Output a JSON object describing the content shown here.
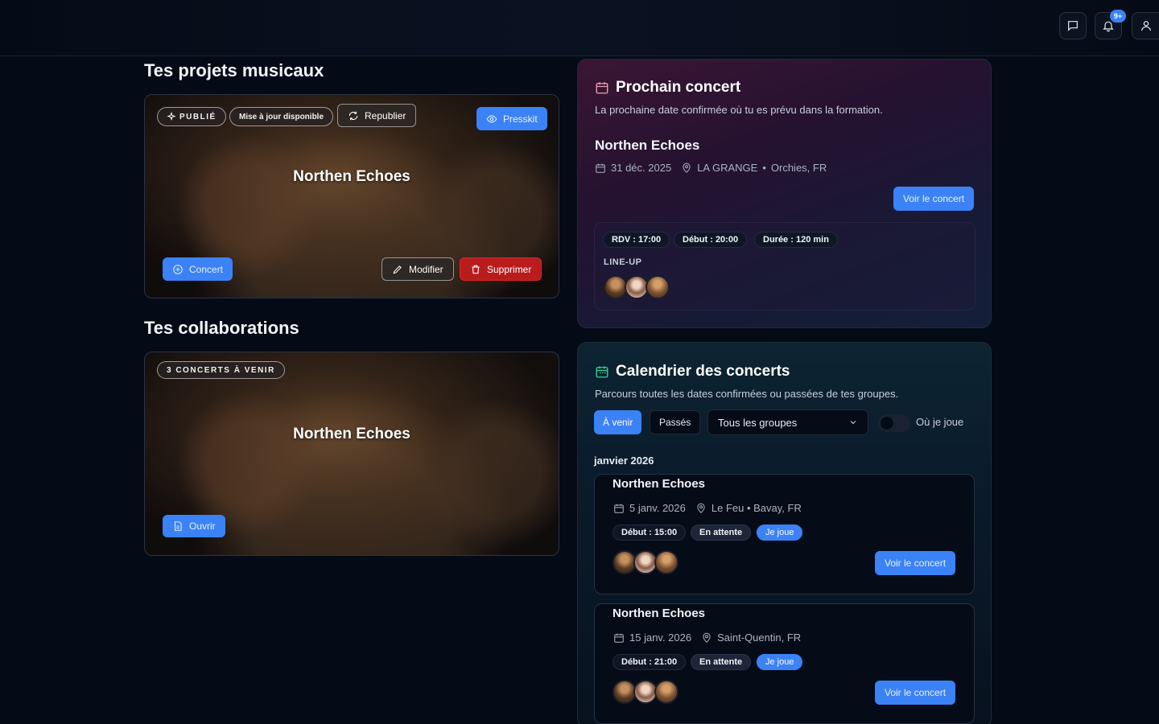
{
  "header": {
    "notification_count": "9+"
  },
  "projects": {
    "title": "Tes projets musicaux",
    "card": {
      "name": "Northen Echoes",
      "status_pill": "PUBLIÉ",
      "update_pill": "Mise à jour disponible",
      "republish_label": "Republier",
      "presskit_label": "Presskit",
      "concert_label": "Concert",
      "edit_label": "Modifier",
      "delete_label": "Supprimer"
    }
  },
  "collaborations": {
    "title": "Tes collaborations",
    "card": {
      "name": "Northen Echoes",
      "pill": "3 CONCERTS À VENIR",
      "open_label": "Ouvrir"
    }
  },
  "next_concert": {
    "title": "Prochain concert",
    "subtitle": "La prochaine date confirmée où tu es prévu dans la formation.",
    "band": "Northen Echoes",
    "date": "31 déc. 2025",
    "venue": "LA GRANGE",
    "city": "Orchies, FR",
    "view_label": "Voir le concert",
    "rdv": "RDV : 17:00",
    "start": "Début : 20:00",
    "duration": "Durée : 120 min",
    "lineup_label": "LINE-UP"
  },
  "calendar": {
    "title": "Calendrier des concerts",
    "subtitle": "Parcours toutes les dates confirmées ou passées de tes groupes.",
    "tab_upcoming": "À venir",
    "tab_past": "Passés",
    "group_select": "Tous les groupes",
    "toggle_label": "Où je joue",
    "month": "janvier 2026",
    "events": [
      {
        "band": "Northen Echoes",
        "date": "5 janv. 2026",
        "location": "Le Feu • Bavay, FR",
        "start": "Début : 15:00",
        "status": "En attente",
        "role": "Je joue",
        "view_label": "Voir le concert"
      },
      {
        "band": "Northen Echoes",
        "date": "15 janv. 2026",
        "location": "Saint-Quentin, FR",
        "start": "Début : 21:00",
        "status": "En attente",
        "role": "Je joue",
        "view_label": "Voir le concert"
      }
    ]
  },
  "colors": {
    "accent": "#3b82f6",
    "danger": "#b91c1c",
    "background": "#050b16"
  }
}
